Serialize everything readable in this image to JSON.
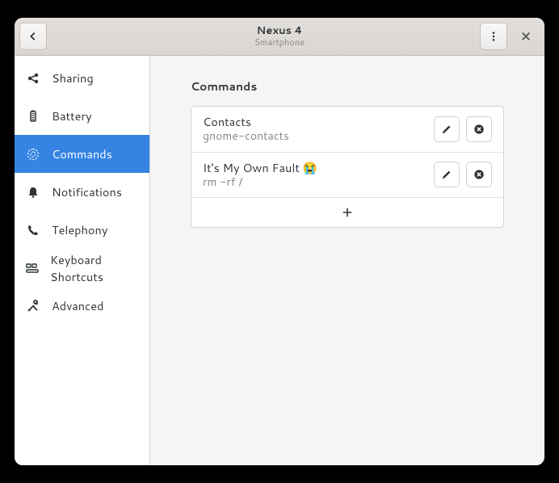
{
  "header": {
    "title": "Nexus 4",
    "subtitle": "Smartphone"
  },
  "sidebar": {
    "items": [
      {
        "label": "Sharing",
        "icon": "share"
      },
      {
        "label": "Battery",
        "icon": "battery"
      },
      {
        "label": "Commands",
        "icon": "gear"
      },
      {
        "label": "Notifications",
        "icon": "bell"
      },
      {
        "label": "Telephony",
        "icon": "phone"
      },
      {
        "label": "Keyboard Shortcuts",
        "icon": "keyboard"
      },
      {
        "label": "Advanced",
        "icon": "tools"
      }
    ],
    "selected_index": 2
  },
  "main": {
    "section_title": "Commands",
    "commands": [
      {
        "title": "Contacts",
        "subtitle": "gnome-contacts"
      },
      {
        "title": "It's My Own Fault 😭",
        "subtitle": "rm -rf /"
      }
    ]
  }
}
